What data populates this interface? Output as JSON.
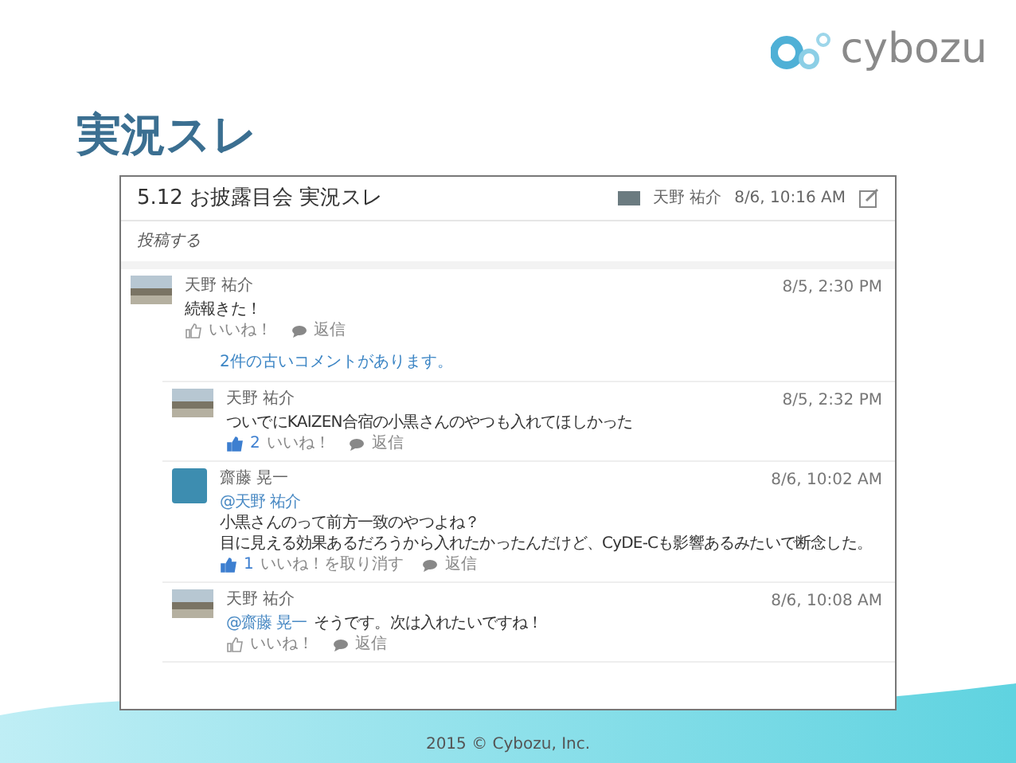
{
  "logo": {
    "text": "cybozu"
  },
  "slide_title": "実況スレ",
  "thread": {
    "title": "5.12 お披露目会 実況スレ",
    "author": "天野 祐介",
    "time": "8/6, 10:16 AM",
    "post_prompt": "投稿する",
    "comments": [
      {
        "author": "天野 祐介",
        "avatar": {
          "kind": "photo"
        },
        "time": "8/5, 2:30 PM",
        "lines": [
          "続報きた！"
        ],
        "liked": false,
        "like_label": "いいね！",
        "reply_label": "返信",
        "older_link": "2件の古いコメントがあります。",
        "children": [
          {
            "author": "天野 祐介",
            "avatar": {
              "kind": "photo"
            },
            "time": "8/5, 2:32 PM",
            "lines": [
              "ついでにKAIZEN合宿の小黒さんのやつも入れてほしかった"
            ],
            "liked": true,
            "like_count": "2",
            "like_label": "いいね！",
            "reply_label": "返信"
          },
          {
            "author": "齋藤 晃一",
            "avatar": {
              "kind": "character"
            },
            "time": "8/6, 10:02 AM",
            "mention_line": "@天野 祐介",
            "lines": [
              "小黒さんのって前方一致のやつよね？",
              "目に見える効果あるだろうから入れたかったんだけど、CyDE-Cも影響あるみたいで断念した。"
            ],
            "liked": true,
            "like_count": "1",
            "like_label": "いいね！を取り消す",
            "reply_label": "返信"
          },
          {
            "author": "天野 祐介",
            "avatar": {
              "kind": "photo"
            },
            "time": "8/6, 10:08 AM",
            "inline_mention": "@齋藤 晃一",
            "lines": [
              "そうです。次は入れたいですね！"
            ],
            "liked": false,
            "like_label": "いいね！",
            "reply_label": "返信"
          }
        ]
      }
    ]
  },
  "footer": "2015 © Cybozu, Inc."
}
